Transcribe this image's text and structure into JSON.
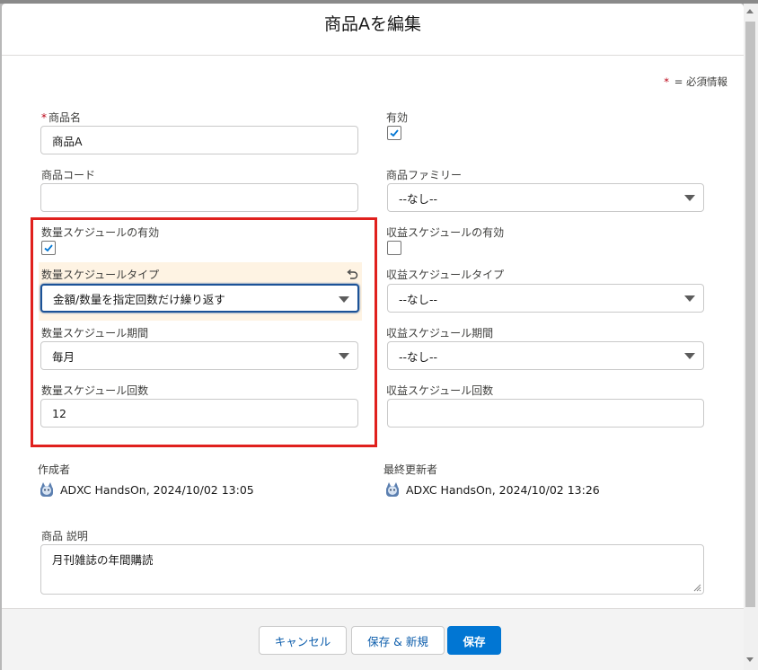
{
  "modal": {
    "title": "商品Aを編集"
  },
  "legend": {
    "asterisk": "*",
    "text": "= 必須情報"
  },
  "fields": {
    "product_name": {
      "asterisk": "*",
      "label": "商品名",
      "value": "商品A"
    },
    "active": {
      "label": "有効",
      "checked": true
    },
    "product_code": {
      "label": "商品コード",
      "value": ""
    },
    "product_family": {
      "label": "商品ファミリー",
      "value": "--なし--"
    },
    "qty_schedule_enabled": {
      "label": "数量スケジュールの有効",
      "checked": true
    },
    "rev_schedule_enabled": {
      "label": "収益スケジュールの有効",
      "checked": false
    },
    "qty_schedule_type": {
      "label": "数量スケジュールタイプ",
      "value": "金額/数量を指定回数だけ繰り返す"
    },
    "rev_schedule_type": {
      "label": "収益スケジュールタイプ",
      "value": "--なし--"
    },
    "qty_schedule_period": {
      "label": "数量スケジュール期間",
      "value": "毎月"
    },
    "rev_schedule_period": {
      "label": "収益スケジュール期間",
      "value": "--なし--"
    },
    "qty_schedule_count": {
      "label": "数量スケジュール回数",
      "value": "12"
    },
    "rev_schedule_count": {
      "label": "収益スケジュール回数",
      "value": ""
    }
  },
  "meta": {
    "created_by": {
      "label": "作成者",
      "user": "ADXC HandsOn",
      "timestamp": ", 2024/10/02 13:05"
    },
    "modified_by": {
      "label": "最終更新者",
      "user": "ADXC HandsOn",
      "timestamp": ", 2024/10/02 13:26"
    }
  },
  "description": {
    "label": "商品 説明",
    "value": "月刊雑誌の年間購読"
  },
  "footer": {
    "cancel": "キャンセル",
    "save_new": "保存 & 新規",
    "save": "保存"
  },
  "colors": {
    "brand": "#0176d3",
    "highlight": "#e0201d",
    "changed_bg": "#fef3e3",
    "focus": "#1b5297"
  }
}
